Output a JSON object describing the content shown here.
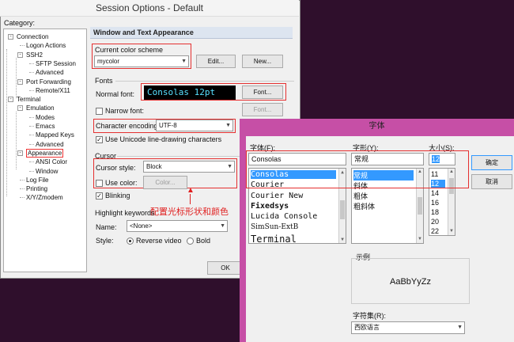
{
  "session_window": {
    "title": "Session Options - Default",
    "category_label": "Category:",
    "tree": [
      {
        "label": "Connection",
        "depth": 0,
        "toggle": "-"
      },
      {
        "label": "Logon Actions",
        "depth": 1
      },
      {
        "label": "SSH2",
        "depth": 1,
        "toggle": "-"
      },
      {
        "label": "SFTP Session",
        "depth": 2
      },
      {
        "label": "Advanced",
        "depth": 2
      },
      {
        "label": "Port Forwarding",
        "depth": 1,
        "toggle": "-"
      },
      {
        "label": "Remote/X11",
        "depth": 2
      },
      {
        "label": "Terminal",
        "depth": 0,
        "toggle": "-"
      },
      {
        "label": "Emulation",
        "depth": 1,
        "toggle": "-"
      },
      {
        "label": "Modes",
        "depth": 2
      },
      {
        "label": "Emacs",
        "depth": 2
      },
      {
        "label": "Mapped Keys",
        "depth": 2
      },
      {
        "label": "Advanced",
        "depth": 2
      },
      {
        "label": "Appearance",
        "depth": 1,
        "toggle": "-",
        "selected": true
      },
      {
        "label": "ANSI Color",
        "depth": 2
      },
      {
        "label": "Window",
        "depth": 2
      },
      {
        "label": "Log File",
        "depth": 1
      },
      {
        "label": "Printing",
        "depth": 1
      },
      {
        "label": "X/Y/Zmodem",
        "depth": 1
      }
    ],
    "panel_title": "Window and Text Appearance",
    "color_scheme": {
      "label": "Current color scheme",
      "value": "mycolor",
      "edit_button": "Edit...",
      "new_button": "New..."
    },
    "fonts": {
      "group": "Fonts",
      "normal_label": "Normal font:",
      "normal_preview": "Consolas 12pt",
      "font_button": "Font...",
      "narrow_label": "Narrow font:",
      "narrow_button": "Font..."
    },
    "encoding": {
      "label": "Character encoding:",
      "value": "UTF-8"
    },
    "unicode_line": {
      "label": "Use Unicode line-drawing characters",
      "checked": true
    },
    "cursor": {
      "group": "Cursor",
      "style_label": "Cursor style:",
      "style_value": "Block",
      "use_color_label": "Use color:",
      "color_button": "Color...",
      "blinking_label": "Blinking",
      "blinking_checked": true
    },
    "annotation": "配置光标形状和颜色",
    "highlight": {
      "group": "Highlight keywords",
      "name_label": "Name:",
      "name_value": "<None>",
      "style_label": "Style:",
      "reverse_label": "Reverse video",
      "bold_label": "Bold"
    },
    "ok_button": "OK"
  },
  "font_dialog": {
    "title": "字体",
    "font_label": "字体(F):",
    "font_value": "Consolas",
    "fonts": [
      "Consolas",
      "Courier",
      "Courier New",
      "Fixedsys",
      "Lucida Console",
      "SimSun-ExtB",
      "Terminal"
    ],
    "style_label": "字形(Y):",
    "style_value": "常规",
    "styles": [
      "常规",
      "斜体",
      "粗体",
      "粗斜体"
    ],
    "size_label": "大小(S):",
    "size_value": "12",
    "sizes": [
      "11",
      "12",
      "14",
      "16",
      "18",
      "20",
      "22"
    ],
    "ok_button": "确定",
    "cancel_button": "取消",
    "sample_label": "示例",
    "sample_text": "AaBbYyZz",
    "charset_label": "字符集(R):",
    "charset_value": "西欧语言"
  },
  "colors": {
    "desktop": "#2f0f2c",
    "dialog_border": "#c64fa6",
    "selection": "#3399ff",
    "annotation_red": "#e02020",
    "preview_text": "#58e0ff"
  }
}
